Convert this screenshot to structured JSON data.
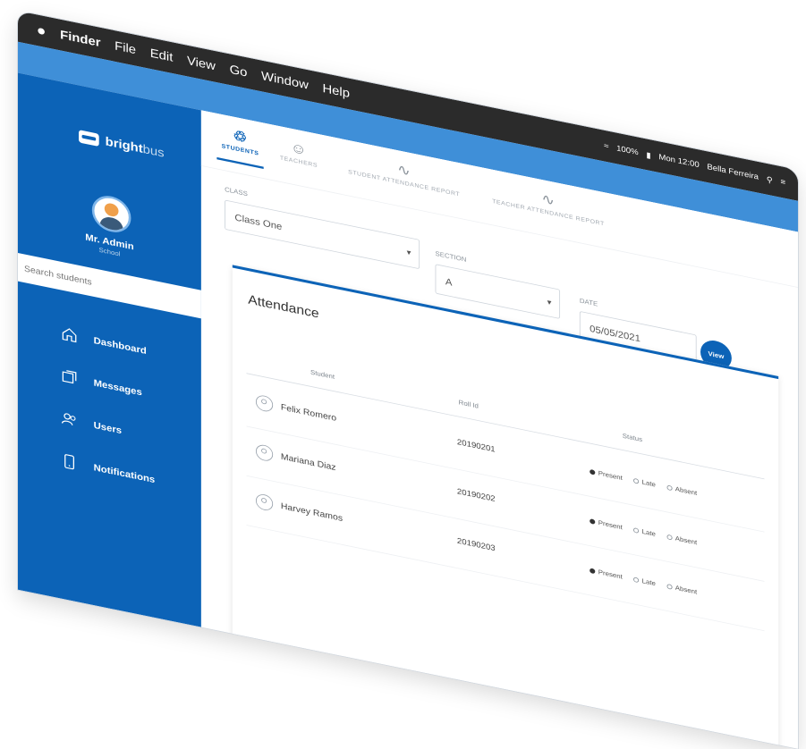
{
  "menubar": {
    "apple": "",
    "items": [
      "Finder",
      "File",
      "Edit",
      "View",
      "Go",
      "Window",
      "Help"
    ],
    "status": {
      "battery": "100%",
      "datetime": "Mon 12:00",
      "user": "Bella Ferreira"
    }
  },
  "sidebar": {
    "brand_bold": "bright",
    "brand_light": "bus",
    "user_name": "Mr. Admin",
    "user_role": "School",
    "search_placeholder": "Search students",
    "nav": [
      {
        "label": "Dashboard",
        "icon": "home-icon"
      },
      {
        "label": "Messages",
        "icon": "messages-icon"
      },
      {
        "label": "Users",
        "icon": "users-icon"
      },
      {
        "label": "Notifications",
        "icon": "phone-icon"
      }
    ]
  },
  "tabs": [
    {
      "label": "STUDENTS",
      "icon": "students-icon",
      "active": true
    },
    {
      "label": "TEACHERS",
      "icon": "teachers-icon",
      "active": false
    },
    {
      "label": "STUDENT ATTENDANCE REPORT",
      "icon": "chart-icon",
      "active": false
    },
    {
      "label": "TEACHER ATTENDANCE REPORT",
      "icon": "chart-icon",
      "active": false
    }
  ],
  "filters": {
    "class_label": "CLASS",
    "class_value": "Class One",
    "section_label": "SECTION",
    "section_value": "A",
    "date_label": "DATE",
    "date_value": "05/05/2021",
    "view_button": "View"
  },
  "attendance": {
    "title": "Attendance",
    "columns": [
      "Student",
      "Roll Id",
      "Status"
    ],
    "status_options": [
      "Present",
      "Late",
      "Absent"
    ],
    "rows": [
      {
        "name": "Felix Romero",
        "roll": "20190201",
        "status": "Present"
      },
      {
        "name": "Mariana Diaz",
        "roll": "20190202",
        "status": "Present"
      },
      {
        "name": "Harvey Ramos",
        "roll": "20190203",
        "status": "Present"
      }
    ]
  }
}
